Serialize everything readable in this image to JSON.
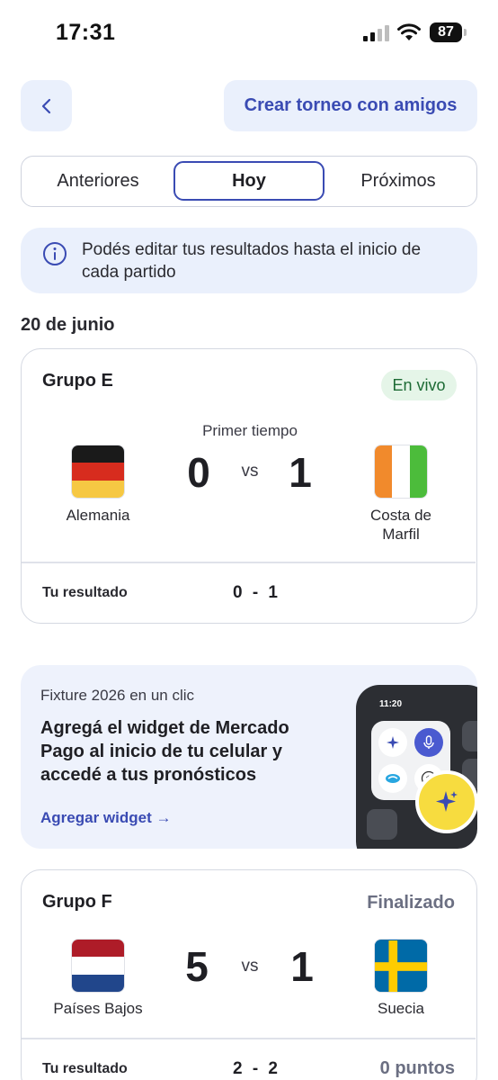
{
  "status_bar": {
    "time": "17:31",
    "battery": "87"
  },
  "header": {
    "create_label": "Crear torneo con amigos"
  },
  "tabs": [
    {
      "label": "Anteriores"
    },
    {
      "label": "Hoy"
    },
    {
      "label": "Próximos"
    }
  ],
  "info": {
    "text": "Podés editar tus resultados hasta el inicio de cada partido"
  },
  "date": "20 de junio",
  "matches": [
    {
      "group": "Grupo E",
      "status": "En vivo",
      "period": "Primer tiempo",
      "home": {
        "name": "Alemania",
        "score": "0",
        "flag_colors": [
          "#1a1a1a",
          "#d72c1e",
          "#f6c843"
        ]
      },
      "vs": "vs",
      "away": {
        "name": "Costa de Marfil",
        "score": "1",
        "flag_colors": [
          "#f18a2c",
          "#ffffff",
          "#4cbc3b"
        ]
      },
      "your_result_label": "Tu resultado",
      "your_result": "0 - 1"
    },
    {
      "group": "Grupo F",
      "status": "Finalizado",
      "home": {
        "name": "Países Bajos",
        "score": "5",
        "flag_colors": [
          "#ae1c28",
          "#ffffff",
          "#21468b"
        ]
      },
      "vs": "vs",
      "away": {
        "name": "Suecia",
        "score": "1",
        "flag_colors": [
          "#006aa7",
          "#fecc00"
        ]
      },
      "your_result_label": "Tu resultado",
      "your_result": "2 - 2",
      "points": "0 puntos"
    }
  ],
  "promo": {
    "kicker": "Fixture 2026 en un clic",
    "title": "Agregá el widget de Mercado Pago al inicio de tu celular y accedé a tus pronósticos",
    "link": "Agregar widget →",
    "phone_time": "11:20"
  },
  "colors": {
    "accent": "#3a4bb3",
    "panel": "#eaf0fc",
    "live_bg": "#e5f5e8",
    "live_text": "#1d6b35"
  }
}
